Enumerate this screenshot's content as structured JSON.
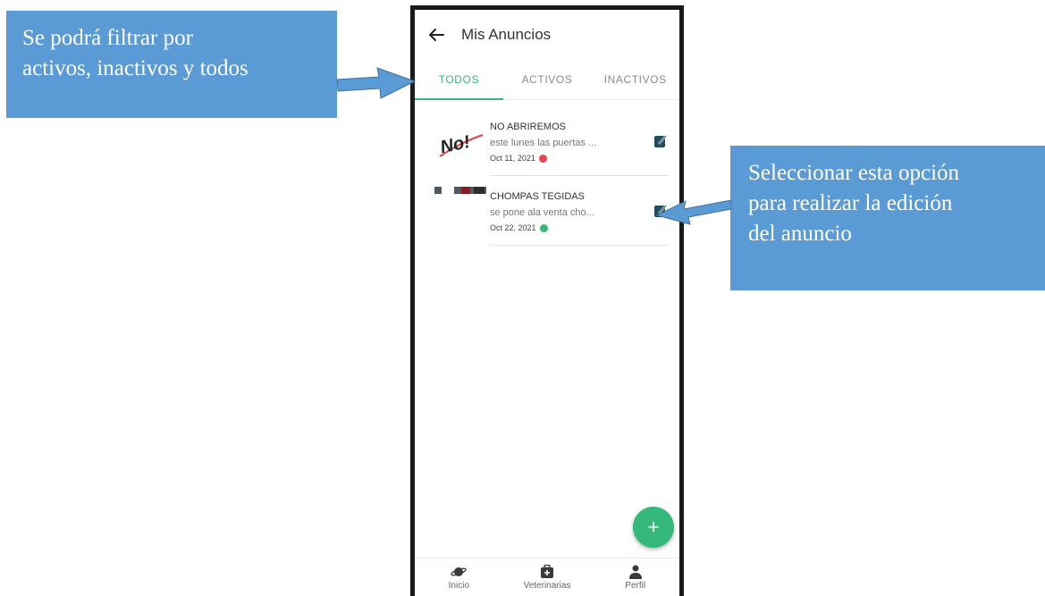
{
  "callouts": {
    "left": [
      "Se podrá filtrar por",
      "activos, inactivos y todos"
    ],
    "right": [
      "Seleccionar esta opción",
      "para realizar la edición",
      "del anuncio"
    ]
  },
  "colors": {
    "callout": "#5b9bd5",
    "accent": "#34b97a",
    "inactive": "#e8434e",
    "edit_icon": "#1f4d5c"
  },
  "appbar": {
    "title": "Mis Anuncios",
    "back_icon": "arrow-left-icon"
  },
  "tabs": [
    {
      "label": "TODOS",
      "active": true
    },
    {
      "label": "ACTIVOS",
      "active": false
    },
    {
      "label": "INACTIVOS",
      "active": false
    }
  ],
  "ads": [
    {
      "title": "NO ABRIREMOS",
      "description": "este lunes las puertas ...",
      "date": "Oct 11, 2021",
      "status": "inactive",
      "thumb_text": "No!"
    },
    {
      "title": "CHOMPAS TEGIDAS",
      "description": "se pone ala venta cho...",
      "date": "Oct 22, 2021",
      "status": "active"
    }
  ],
  "fab": {
    "label": "+"
  },
  "bottom_nav": [
    {
      "label": "Inicio",
      "icon": "planet-icon"
    },
    {
      "label": "Veterinarias",
      "icon": "medical-kit-icon"
    },
    {
      "label": "Perfil",
      "icon": "user-icon"
    }
  ]
}
